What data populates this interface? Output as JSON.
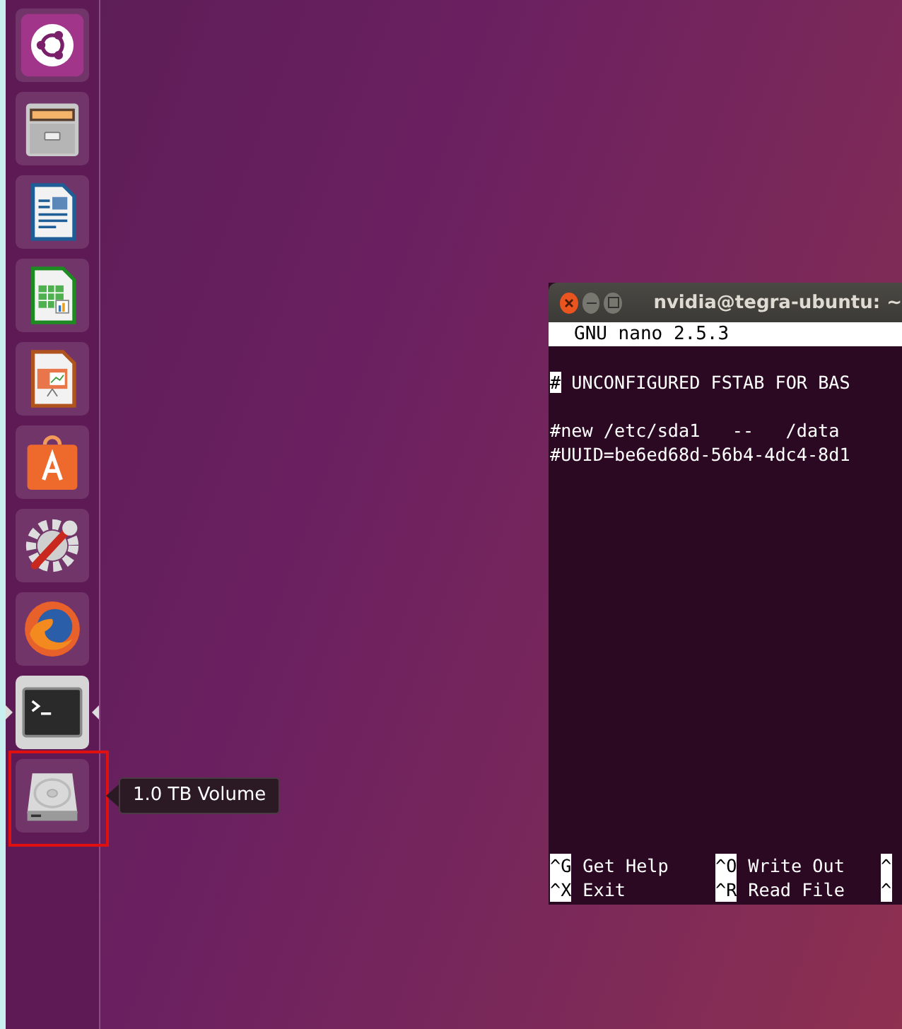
{
  "launcher": {
    "items": [
      {
        "kind": "dash",
        "focused": false,
        "highlighted": false
      },
      {
        "kind": "files",
        "focused": false,
        "highlighted": false
      },
      {
        "kind": "writer",
        "focused": false,
        "highlighted": false
      },
      {
        "kind": "calc",
        "focused": false,
        "highlighted": false
      },
      {
        "kind": "impress",
        "focused": false,
        "highlighted": false
      },
      {
        "kind": "store",
        "focused": false,
        "highlighted": false
      },
      {
        "kind": "settings",
        "focused": false,
        "highlighted": false
      },
      {
        "kind": "browser",
        "focused": false,
        "highlighted": false
      },
      {
        "kind": "terminal",
        "focused": true,
        "highlighted": false
      },
      {
        "kind": "drive",
        "focused": false,
        "highlighted": true,
        "tooltip": "1.0 TB Volume"
      }
    ]
  },
  "terminal": {
    "title": "nvidia@tegra-ubuntu: ~",
    "header": "GNU nano 2.5.3",
    "lines": [
      {
        "kind": "blank"
      },
      {
        "kind": "text",
        "text": "# UNCONFIGURED FSTAB FOR BAS",
        "cursor": true
      },
      {
        "kind": "blank"
      },
      {
        "kind": "text",
        "text": "#new /etc/sda1   --   /data",
        "cursor": false
      },
      {
        "kind": "text",
        "text": "#UUID=be6ed68d-56b4-4dc4-8d1",
        "cursor": false
      }
    ],
    "shortcuts": [
      {
        "key": "^G",
        "label": "Get Help"
      },
      {
        "key": "^X",
        "label": "Exit"
      },
      {
        "key": "^O",
        "label": "Write Out"
      },
      {
        "key": "^R",
        "label": "Read File"
      },
      {
        "key": "^"
      },
      {
        "key": "^"
      }
    ]
  }
}
